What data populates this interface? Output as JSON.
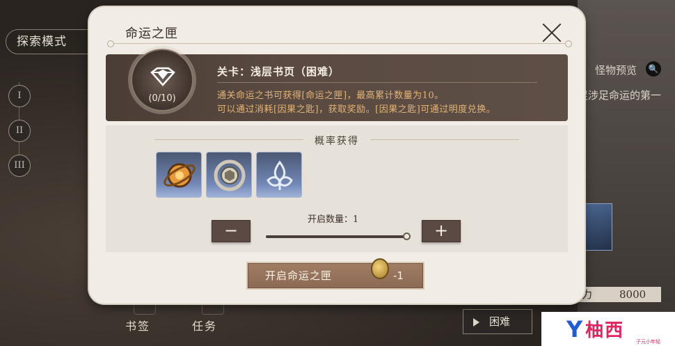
{
  "background": {
    "mode_label": "探索模式",
    "chapters": [
      "I",
      "II",
      "III"
    ],
    "bottom_tabs": [
      "书签",
      "任务"
    ],
    "difficulty_button": "困难",
    "monster_preview": "怪物预览",
    "partial_text": "足涉足命运的第一",
    "power_label": "力",
    "power_value": "8000"
  },
  "modal": {
    "title": "命运之匣",
    "stage_name": "关卡：浅层书页（困难）",
    "description_lines": [
      "通关命运之书可获得[命运之匣]，最高累计数量为10。",
      "可以通过消耗[因果之匙]，获取奖励。[因果之匙]可通过明度兑换。"
    ],
    "count": "(0/10)",
    "drops_title": "概率获得",
    "drop_items": [
      "orb-item-icon",
      "coin-item-icon",
      "rune-item-icon"
    ],
    "minus_label": "−",
    "plus_label": "+",
    "quantity_label": "开启数量：1",
    "quantity_slider_value": 1,
    "open_button_label": "开启命运之匣",
    "open_cost": "-1"
  },
  "watermark": {
    "letter": "Y",
    "text": "柚西",
    "subtext": "子元小年轻"
  },
  "colors": {
    "banner": "#4a3d36",
    "highlight_text": "#e2b475",
    "item_bg": "#7187b5"
  }
}
